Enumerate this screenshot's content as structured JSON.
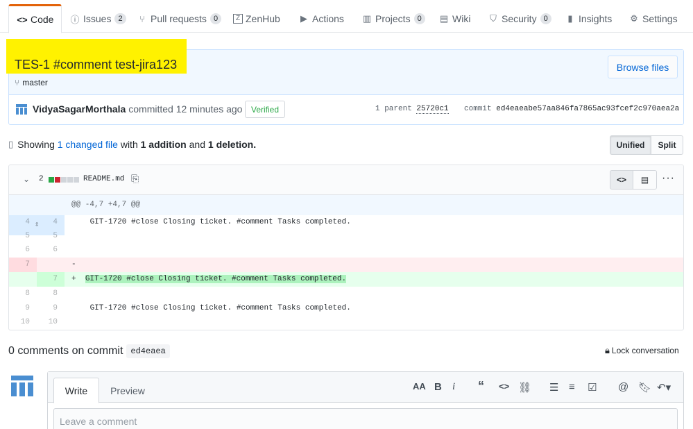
{
  "tabs": [
    {
      "label": "Code",
      "icon": "code-icon",
      "count": null,
      "active": true
    },
    {
      "label": "Issues",
      "icon": "issue-icon",
      "count": "2"
    },
    {
      "label": "Pull requests",
      "icon": "pull-request-icon",
      "count": "0"
    },
    {
      "label": "ZenHub",
      "icon": "zenhub-icon",
      "count": null
    },
    {
      "label": "Actions",
      "icon": "play-icon",
      "count": null
    },
    {
      "label": "Projects",
      "icon": "project-icon",
      "count": "0"
    },
    {
      "label": "Wiki",
      "icon": "book-icon",
      "count": null
    },
    {
      "label": "Security",
      "icon": "shield-icon",
      "count": "0"
    },
    {
      "label": "Insights",
      "icon": "graph-icon",
      "count": null
    },
    {
      "label": "Settings",
      "icon": "gear-icon",
      "count": null
    }
  ],
  "commit": {
    "title": "TES-1 #comment test-jira123",
    "branch": "master",
    "browse_label": "Browse files",
    "author": "VidyaSagarMorthala",
    "committed_text": "committed 12 minutes ago",
    "verified_label": "Verified",
    "parent_label": "1 parent",
    "parent_sha": "25720c1",
    "commit_label": "commit",
    "commit_sha": "ed4eaeabe57aa846fa7865ac93fcef2c970aea2a"
  },
  "toc": {
    "showing": "Showing",
    "changed_link": "1 changed file",
    "with": "with",
    "additions": "1 addition",
    "and": "and",
    "deletions": "1 deletion.",
    "unified_label": "Unified",
    "split_label": "Split"
  },
  "file": {
    "changes_count": "2",
    "name": "README.md",
    "hunk_header": "@@ -4,7 +4,7 @@",
    "lines": [
      {
        "old": "4",
        "new": "4",
        "type": "ctx",
        "text": " GIT-1720 #close Closing ticket. #comment Tasks completed."
      },
      {
        "old": "5",
        "new": "5",
        "type": "ctx",
        "text": ""
      },
      {
        "old": "6",
        "new": "6",
        "type": "ctx",
        "text": ""
      },
      {
        "old": "7",
        "new": "",
        "type": "del",
        "text": "-"
      },
      {
        "old": "",
        "new": "7",
        "type": "add",
        "text": "GIT-1720 #close Closing ticket. #comment Tasks completed."
      },
      {
        "old": "8",
        "new": "8",
        "type": "ctx",
        "text": ""
      },
      {
        "old": "9",
        "new": "9",
        "type": "ctx",
        "text": " GIT-1720 #close Closing ticket. #comment Tasks completed."
      },
      {
        "old": "10",
        "new": "10",
        "type": "ctx",
        "text": ""
      }
    ]
  },
  "comments": {
    "title": "0 comments on commit",
    "sha": "ed4eaea",
    "lock_label": "Lock conversation",
    "write_tab": "Write",
    "preview_tab": "Preview",
    "placeholder": "Leave a comment"
  },
  "colors": {
    "accent_orange": "#e36209",
    "link_blue": "#0366d6",
    "highlight_yellow": "#fff200",
    "add_green": "#28a745",
    "del_red": "#cb2431"
  }
}
